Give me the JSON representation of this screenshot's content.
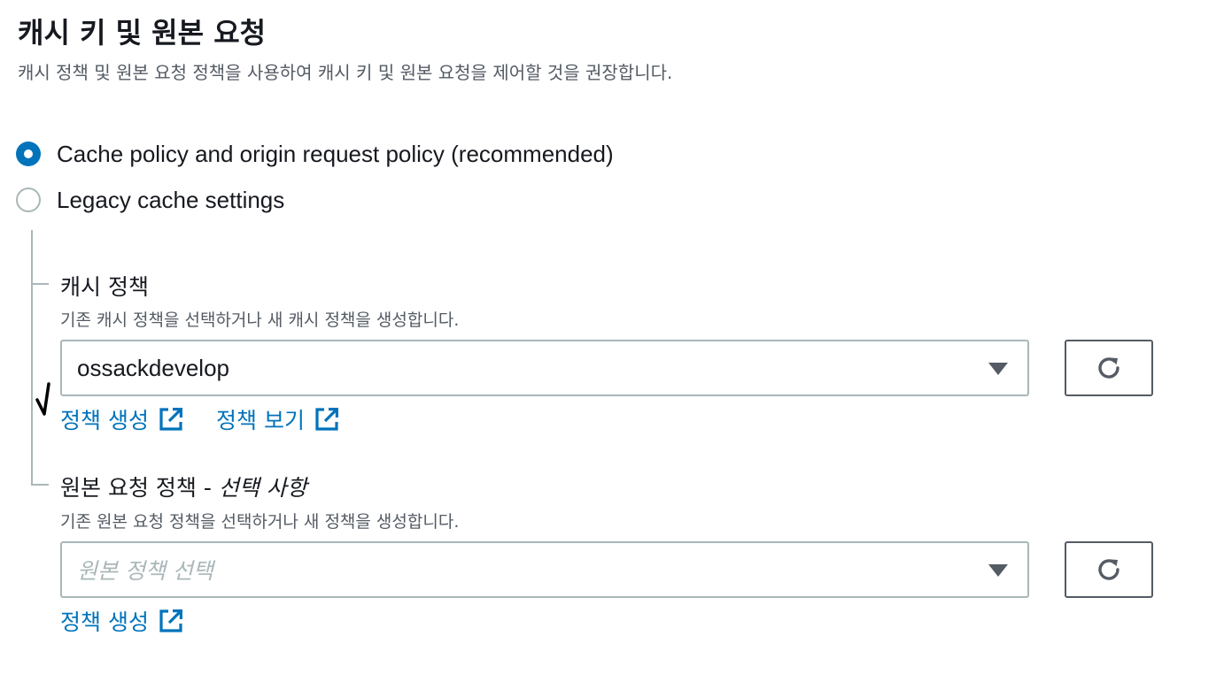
{
  "section": {
    "title": "캐시 키 및 원본 요청",
    "description": "캐시 정책 및 원본 요청 정책을 사용하여 캐시 키 및 원본 요청을 제어할 것을 권장합니다."
  },
  "options": [
    {
      "label": "Cache policy and origin request policy (recommended)",
      "selected": true
    },
    {
      "label": "Legacy cache settings",
      "selected": false
    }
  ],
  "cache_policy": {
    "label": "캐시 정책",
    "description": "기존 캐시 정책을 선택하거나 새 캐시 정책을 생성합니다.",
    "selected_value": "ossackdevelop",
    "create_link": "정책 생성",
    "view_link": "정책 보기"
  },
  "origin_request_policy": {
    "label": "원본 요청 정책 - ",
    "label_optional": "선택 사항",
    "description": "기존 원본 요청 정책을 선택하거나 새 정책을 생성합니다.",
    "placeholder": "원본 정책 선택",
    "create_link": "정책 생성"
  },
  "colors": {
    "accent": "#0073bb",
    "text": "#16191f",
    "secondary_text": "#545b64",
    "border": "#aab7b8"
  },
  "icons": {
    "external_link": "external-link-icon",
    "refresh": "refresh-icon",
    "dropdown": "caret-down-icon"
  }
}
